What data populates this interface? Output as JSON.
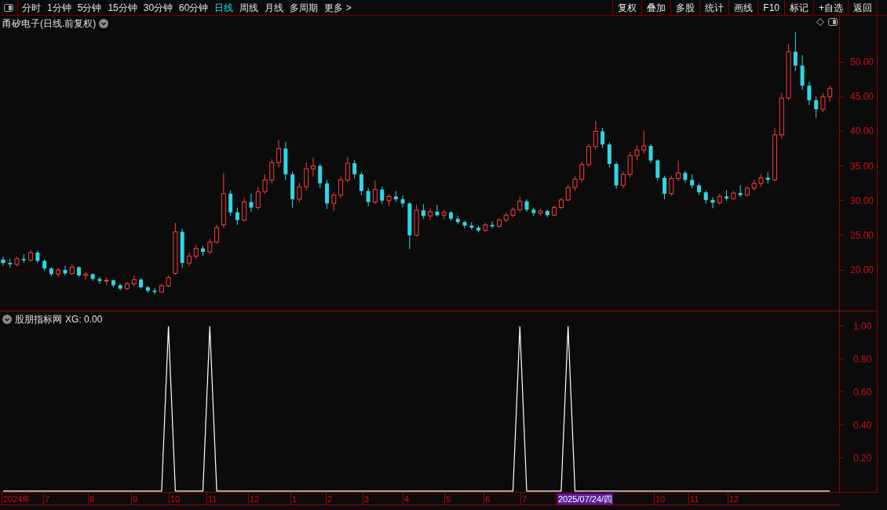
{
  "period_tabs": [
    {
      "label": "分时",
      "selected": false
    },
    {
      "label": "1分钟",
      "selected": false
    },
    {
      "label": "5分钟",
      "selected": false
    },
    {
      "label": "15分钟",
      "selected": false
    },
    {
      "label": "30分钟",
      "selected": false
    },
    {
      "label": "60分钟",
      "selected": false
    },
    {
      "label": "日线",
      "selected": true
    },
    {
      "label": "周线",
      "selected": false
    },
    {
      "label": "月线",
      "selected": false
    },
    {
      "label": "多周期",
      "selected": false
    },
    {
      "label": "更多 >",
      "selected": false
    }
  ],
  "toolbar_buttons": [
    "复权",
    "叠加",
    "多股",
    "统计",
    "画线",
    "F10",
    "标记",
    "+自选",
    "返回"
  ],
  "main_chart": {
    "title": "甬矽电子(日线.前复权)",
    "chart_data": {
      "type": "candlestick",
      "grid": true,
      "ylim": [
        14,
        56.7
      ],
      "yticks": [
        {
          "value": 50,
          "label": "50.00"
        },
        {
          "value": 45,
          "label": "45.00"
        },
        {
          "value": 40,
          "label": "40.00"
        },
        {
          "value": 35,
          "label": "35.00"
        },
        {
          "value": 30,
          "label": "30.00"
        },
        {
          "value": 25,
          "label": "25.00"
        },
        {
          "value": 20,
          "label": "20.00"
        }
      ],
      "ohlc": [
        [
          21.5,
          21.9,
          20.6,
          21.0
        ],
        [
          21.0,
          21.6,
          20.3,
          20.8
        ],
        [
          20.8,
          21.9,
          20.5,
          21.6
        ],
        [
          21.6,
          22.3,
          21.0,
          21.4
        ],
        [
          21.4,
          22.9,
          21.2,
          22.5
        ],
        [
          22.5,
          22.8,
          21.0,
          21.3
        ],
        [
          21.3,
          21.5,
          19.9,
          20.2
        ],
        [
          20.2,
          20.4,
          19.1,
          19.4
        ],
        [
          19.4,
          20.3,
          19.0,
          20.0
        ],
        [
          20.0,
          20.6,
          19.2,
          19.5
        ],
        [
          19.5,
          20.8,
          19.3,
          20.4
        ],
        [
          20.4,
          20.5,
          19.0,
          19.2
        ],
        [
          19.2,
          19.7,
          18.6,
          19.4
        ],
        [
          19.4,
          19.5,
          18.4,
          18.7
        ],
        [
          18.7,
          19.0,
          18.0,
          18.4
        ],
        [
          18.4,
          18.9,
          17.8,
          18.5
        ],
        [
          18.5,
          18.6,
          17.5,
          17.8
        ],
        [
          17.8,
          18.0,
          17.0,
          17.3
        ],
        [
          17.3,
          18.3,
          17.1,
          18.0
        ],
        [
          18.0,
          19.2,
          17.6,
          18.6
        ],
        [
          18.6,
          18.8,
          17.3,
          17.5
        ],
        [
          17.5,
          17.7,
          16.7,
          17.0
        ],
        [
          17.0,
          17.4,
          16.5,
          16.8
        ],
        [
          16.8,
          18.0,
          16.7,
          17.7
        ],
        [
          17.7,
          19.2,
          17.5,
          18.9
        ],
        [
          19.5,
          26.8,
          19.3,
          25.5
        ],
        [
          25.5,
          25.9,
          20.3,
          21.0
        ],
        [
          21.0,
          22.5,
          20.5,
          22.0
        ],
        [
          22.0,
          23.6,
          21.6,
          23.1
        ],
        [
          23.1,
          23.5,
          22.0,
          22.6
        ],
        [
          22.6,
          24.5,
          22.3,
          24.0
        ],
        [
          24.0,
          26.5,
          23.8,
          26.1
        ],
        [
          26.5,
          34.0,
          26.0,
          31.0
        ],
        [
          31.0,
          31.5,
          27.8,
          28.3
        ],
        [
          28.3,
          29.0,
          26.5,
          27.2
        ],
        [
          27.2,
          30.4,
          27.0,
          29.8
        ],
        [
          29.8,
          31.0,
          28.4,
          29.0
        ],
        [
          29.0,
          32.0,
          28.7,
          31.3
        ],
        [
          31.3,
          33.8,
          31.0,
          33.0
        ],
        [
          33.0,
          36.0,
          32.5,
          35.5
        ],
        [
          35.5,
          38.8,
          34.8,
          37.5
        ],
        [
          37.5,
          38.5,
          33.0,
          33.8
        ],
        [
          33.8,
          34.2,
          29.0,
          30.2
        ],
        [
          30.2,
          32.6,
          29.8,
          32.0
        ],
        [
          32.0,
          35.5,
          31.5,
          34.6
        ],
        [
          34.6,
          36.2,
          33.5,
          35.0
        ],
        [
          35.0,
          35.3,
          31.8,
          32.5
        ],
        [
          32.5,
          33.0,
          28.8,
          29.6
        ],
        [
          29.6,
          31.2,
          28.5,
          30.8
        ],
        [
          30.8,
          33.5,
          30.3,
          33.0
        ],
        [
          33.0,
          36.3,
          32.6,
          35.4
        ],
        [
          35.4,
          35.9,
          33.2,
          33.8
        ],
        [
          33.8,
          34.1,
          30.8,
          31.4
        ],
        [
          31.4,
          31.8,
          29.2,
          29.8
        ],
        [
          29.8,
          32.9,
          29.5,
          31.6
        ],
        [
          31.6,
          32.0,
          29.5,
          30.0
        ],
        [
          30.0,
          31.0,
          29.2,
          30.6
        ],
        [
          30.6,
          31.4,
          29.8,
          30.2
        ],
        [
          30.2,
          30.8,
          29.0,
          29.6
        ],
        [
          29.6,
          29.8,
          23.0,
          25.0
        ],
        [
          25.0,
          29.4,
          24.8,
          28.6
        ],
        [
          28.6,
          29.5,
          27.4,
          27.8
        ],
        [
          27.8,
          28.9,
          27.2,
          28.4
        ],
        [
          28.4,
          29.4,
          27.7,
          27.9
        ],
        [
          27.9,
          28.7,
          27.3,
          28.3
        ],
        [
          28.3,
          28.5,
          27.1,
          27.4
        ],
        [
          27.4,
          27.8,
          26.6,
          26.9
        ],
        [
          26.9,
          27.1,
          26.0,
          26.4
        ],
        [
          26.4,
          26.9,
          25.8,
          26.1
        ],
        [
          26.1,
          26.4,
          25.4,
          25.7
        ],
        [
          25.7,
          26.8,
          25.5,
          26.5
        ],
        [
          26.5,
          27.0,
          26.0,
          26.3
        ],
        [
          26.3,
          27.5,
          26.1,
          27.2
        ],
        [
          27.2,
          28.2,
          26.9,
          27.9
        ],
        [
          27.9,
          29.0,
          27.6,
          28.7
        ],
        [
          28.7,
          30.6,
          28.4,
          29.9
        ],
        [
          29.9,
          30.2,
          28.4,
          28.7
        ],
        [
          28.7,
          29.0,
          27.8,
          28.2
        ],
        [
          28.2,
          28.8,
          27.8,
          28.5
        ],
        [
          28.5,
          28.7,
          27.6,
          27.9
        ],
        [
          27.9,
          29.3,
          27.7,
          29.0
        ],
        [
          29.0,
          30.4,
          28.8,
          30.1
        ],
        [
          30.1,
          32.3,
          29.9,
          31.9
        ],
        [
          31.9,
          33.5,
          31.4,
          33.1
        ],
        [
          33.1,
          35.6,
          32.7,
          35.2
        ],
        [
          35.2,
          38.2,
          34.9,
          37.8
        ],
        [
          37.8,
          41.5,
          37.4,
          40.0
        ],
        [
          40.0,
          40.5,
          37.6,
          38.1
        ],
        [
          38.1,
          38.4,
          34.8,
          35.3
        ],
        [
          35.3,
          35.6,
          31.7,
          32.2
        ],
        [
          32.2,
          34.2,
          31.8,
          33.8
        ],
        [
          33.8,
          37.0,
          33.4,
          36.5
        ],
        [
          36.5,
          38.0,
          35.8,
          37.3
        ],
        [
          37.3,
          40.1,
          36.8,
          37.9
        ],
        [
          37.9,
          38.2,
          35.4,
          35.8
        ],
        [
          35.8,
          36.0,
          32.9,
          33.3
        ],
        [
          33.3,
          33.6,
          30.2,
          31.0
        ],
        [
          31.0,
          33.6,
          30.7,
          33.2
        ],
        [
          33.2,
          35.8,
          32.8,
          34.0
        ],
        [
          34.0,
          34.3,
          32.6,
          33.0
        ],
        [
          33.0,
          33.8,
          31.8,
          32.2
        ],
        [
          32.2,
          32.5,
          30.8,
          31.2
        ],
        [
          31.2,
          31.5,
          29.6,
          30.1
        ],
        [
          30.1,
          30.5,
          28.9,
          29.7
        ],
        [
          29.7,
          31.0,
          29.4,
          30.6
        ],
        [
          30.6,
          31.5,
          30.0,
          30.3
        ],
        [
          30.3,
          31.4,
          30.1,
          31.1
        ],
        [
          31.1,
          32.2,
          30.5,
          30.8
        ],
        [
          30.8,
          32.1,
          30.6,
          31.8
        ],
        [
          31.8,
          33.0,
          31.4,
          32.5
        ],
        [
          32.5,
          33.8,
          32.0,
          33.3
        ],
        [
          33.3,
          34.1,
          32.5,
          33.0
        ],
        [
          33.0,
          40.5,
          32.8,
          39.5
        ],
        [
          39.5,
          45.6,
          39.0,
          44.8
        ],
        [
          44.8,
          52.6,
          44.5,
          51.5
        ],
        [
          51.5,
          54.3,
          48.7,
          49.5
        ],
        [
          49.5,
          51.0,
          46.0,
          46.6
        ],
        [
          46.6,
          47.2,
          43.8,
          44.5
        ],
        [
          44.5,
          45.0,
          42.0,
          43.2
        ],
        [
          43.2,
          45.5,
          42.8,
          45.0
        ],
        [
          45.0,
          46.6,
          44.3,
          46.2
        ]
      ]
    }
  },
  "indicator": {
    "name": "股朋指标网",
    "reading": "XG: 0.00",
    "chart_data": {
      "type": "line",
      "grid": true,
      "ylim": [
        -0.01,
        1.09
      ],
      "yticks": [
        {
          "value": 1,
          "label": "1.00"
        },
        {
          "value": 0.8,
          "label": "0.80"
        },
        {
          "value": 0.6,
          "label": "0.60"
        },
        {
          "value": 0.4,
          "label": "0.40"
        },
        {
          "value": 0.2,
          "label": "0.20"
        }
      ],
      "series": [
        {
          "color": "#ffffff",
          "values": [
            0,
            0,
            0,
            0,
            0,
            0,
            0,
            0,
            0,
            0,
            0,
            0,
            0,
            0,
            0,
            0,
            0,
            0,
            0,
            0,
            0,
            0,
            0,
            0,
            1,
            0,
            0,
            0,
            0,
            0,
            1,
            0,
            0,
            0,
            0,
            0,
            0,
            0,
            0,
            0,
            0,
            0,
            0,
            0,
            0,
            0,
            0,
            0,
            0,
            0,
            0,
            0,
            0,
            0,
            0,
            0,
            0,
            0,
            0,
            0,
            0,
            0,
            0,
            0,
            0,
            0,
            0,
            0,
            0,
            0,
            0,
            0,
            0,
            0,
            0,
            1,
            0,
            0,
            0,
            0,
            0,
            0,
            1,
            0,
            0,
            0,
            0,
            0,
            0,
            0,
            0,
            0,
            0,
            0,
            0,
            0,
            0,
            0,
            0,
            0,
            0,
            0,
            0,
            0,
            0,
            0,
            0,
            0,
            0,
            0,
            0,
            0,
            0,
            0,
            0,
            0,
            0,
            0,
            0,
            0,
            0
          ]
        }
      ]
    }
  },
  "date_axis": [
    {
      "label": "2024年",
      "selected": false
    },
    {
      "label": "7",
      "selected": false
    },
    {
      "label": "8",
      "selected": false
    },
    {
      "label": "9",
      "selected": false
    },
    {
      "label": "10",
      "selected": false
    },
    {
      "label": "11",
      "selected": false
    },
    {
      "label": "12",
      "selected": false
    },
    {
      "label": "1",
      "selected": false
    },
    {
      "label": "2",
      "selected": false
    },
    {
      "label": "3",
      "selected": false
    },
    {
      "label": "4",
      "selected": false
    },
    {
      "label": "5",
      "selected": false
    },
    {
      "label": "6",
      "selected": false
    },
    {
      "label": "7",
      "selected": false
    },
    {
      "label": "2025/07/24/四",
      "selected": true
    },
    {
      "label": "10",
      "selected": false
    },
    {
      "label": "11",
      "selected": false
    },
    {
      "label": "12",
      "selected": false
    }
  ]
}
